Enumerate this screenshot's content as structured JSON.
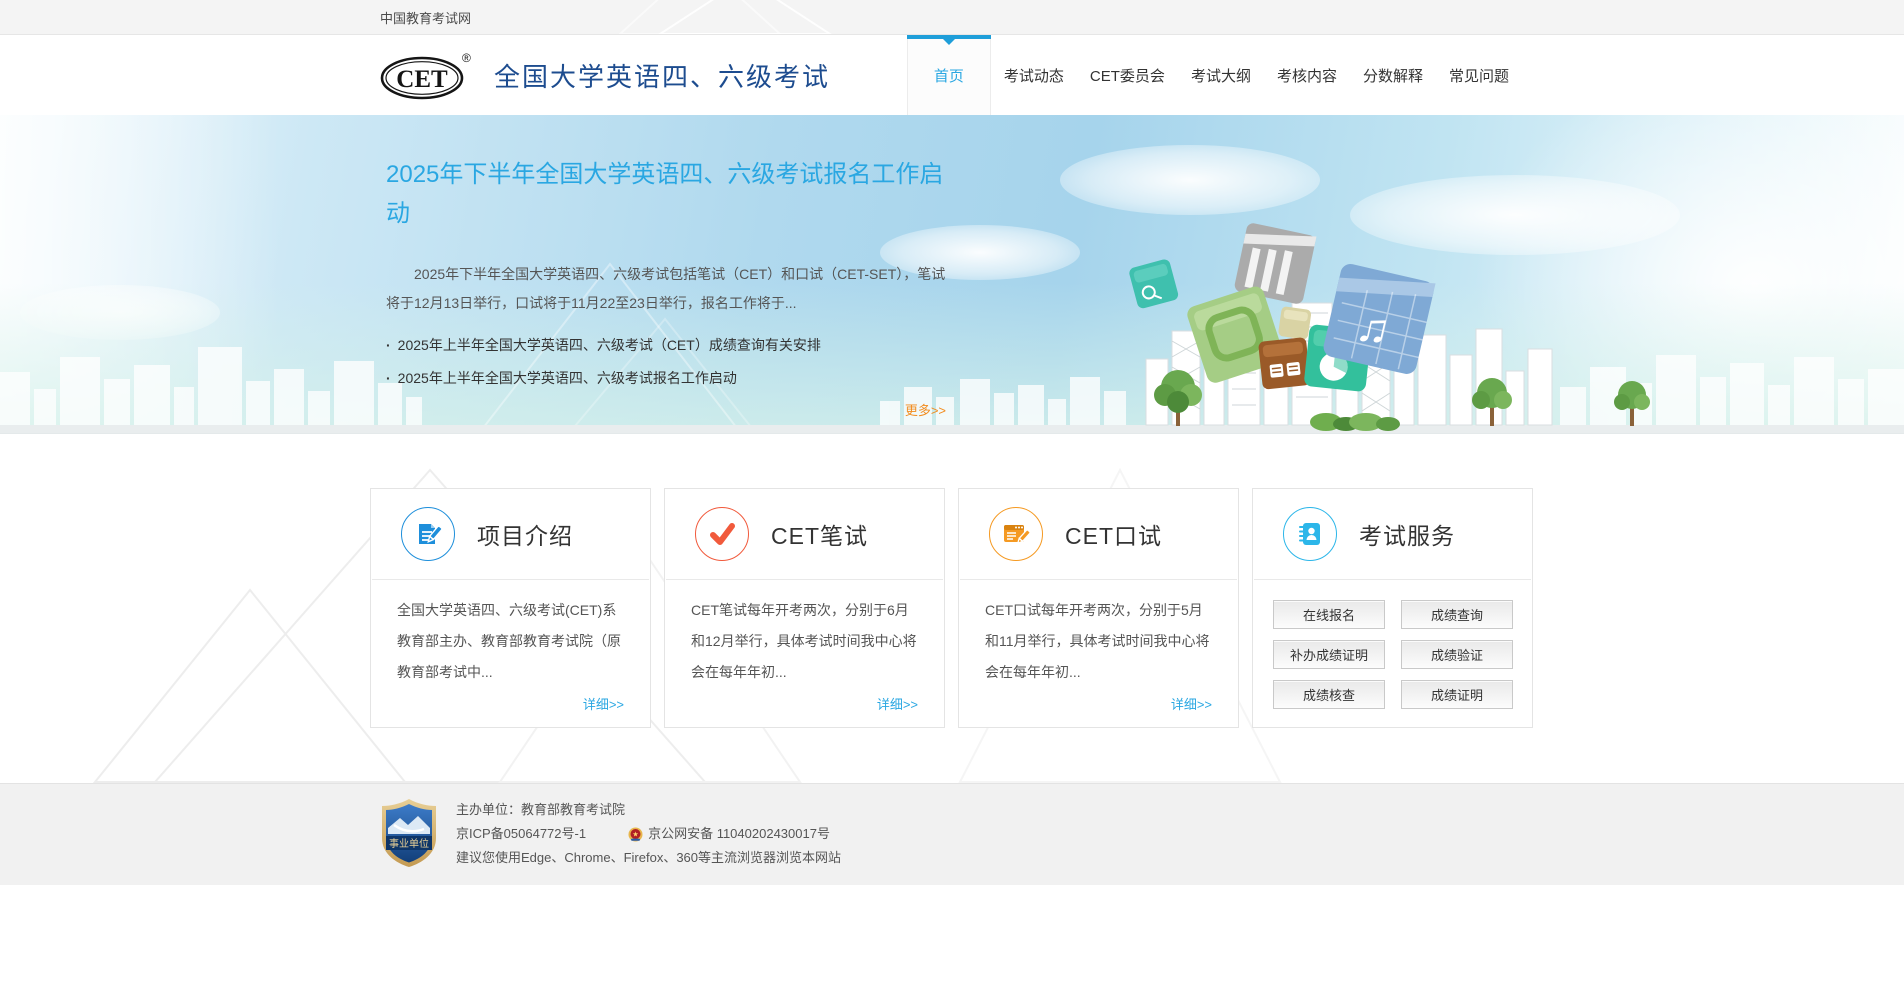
{
  "topbar": {
    "site_name": "中国教育考试网"
  },
  "header": {
    "logo_text": "CET",
    "logo_reg": "®",
    "site_title": "全国大学英语四、六级考试",
    "nav": [
      {
        "label": "首页",
        "active": true
      },
      {
        "label": "考试动态"
      },
      {
        "label": "CET委员会"
      },
      {
        "label": "考试大纲"
      },
      {
        "label": "考核内容"
      },
      {
        "label": "分数解释"
      },
      {
        "label": "常见问题"
      }
    ]
  },
  "hero": {
    "headline": "2025年下半年全国大学英语四、六级考试报名工作启动",
    "summary": "2025年下半年全国大学英语四、六级考试包括笔试（CET）和口试（CET-SET），笔试将于12月13日举行，口试将于11月22至23日举行，报名工作将于...",
    "news": [
      {
        "title": "2025年上半年全国大学英语四、六级考试（CET）成绩查询有关安排"
      },
      {
        "title": "2025年上半年全国大学英语四、六级考试报名工作启动"
      }
    ],
    "more_label": "更多>>"
  },
  "cards": [
    {
      "title": "项目介绍",
      "icon": "document-pencil-icon",
      "accent": "#1e8fdb",
      "body": "全国大学英语四、六级考试(CET)系教育部主办、教育部教育考试院（原教育部考试中...",
      "link_label": "详细>>"
    },
    {
      "title": "CET笔试",
      "icon": "checkmark-icon",
      "accent": "#f15a3c",
      "body": "CET笔试每年开考两次，分别于6月和12月举行，具体考试时间我中心将会在每年年初...",
      "link_label": "详细>>"
    },
    {
      "title": "CET口试",
      "icon": "browser-edit-icon",
      "accent": "#f59a23",
      "body": "CET口试每年开考两次，分别于5月和11月举行，具体考试时间我中心将会在每年年初...",
      "link_label": "详细>>"
    },
    {
      "title": "考试服务",
      "icon": "notebook-person-icon",
      "accent": "#2cb6e9",
      "buttons": [
        "在线报名",
        "成绩查询",
        "补办成绩证明",
        "成绩验证",
        "成绩核查",
        "成绩证明"
      ]
    }
  ],
  "footer": {
    "badge_label": "事业单位",
    "organizer": "主办单位：教育部教育考试院",
    "icp": "京ICP备05064772号-1",
    "police_label": "京公网安备 11040202430017号",
    "browser_tip": "建议您使用Edge、Chrome、Firefox、360等主流浏览器浏览本网站"
  },
  "colors": {
    "nav_active_blue": "#1e9ed9",
    "site_title_navy": "#1d4c8f",
    "headline_blue": "#2aa7e2",
    "more_orange": "#f28c1e",
    "detail_link_blue": "#2aa7e2",
    "card_accents": [
      "#1e8fdb",
      "#f15a3c",
      "#f59a23",
      "#2cb6e9"
    ]
  }
}
